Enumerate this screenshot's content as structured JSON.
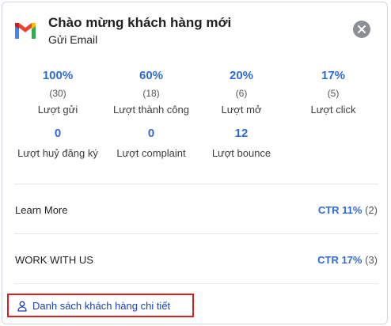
{
  "header": {
    "title": "Chào mừng khách hàng mới",
    "subtitle": "Gửi Email",
    "logo_icon": "gmail-logo-icon",
    "close_icon": "close-icon"
  },
  "stats": [
    {
      "value": "100%",
      "count": "(30)",
      "label": "Lượt gửi"
    },
    {
      "value": "60%",
      "count": "(18)",
      "label": "Lượt thành công"
    },
    {
      "value": "20%",
      "count": "(6)",
      "label": "Lượt mở"
    },
    {
      "value": "17%",
      "count": "(5)",
      "label": "Lượt click"
    },
    {
      "value": "0",
      "label": "Lượt huỷ đăng ký"
    },
    {
      "value": "0",
      "label": "Lượt complaint"
    },
    {
      "value": "12",
      "label": "Lượt bounce"
    }
  ],
  "links": [
    {
      "name": "Learn More",
      "ctr": "CTR 11%",
      "count": "(2)"
    },
    {
      "name": "WORK WITH US",
      "ctr": "CTR 17%",
      "count": "(3)"
    }
  ],
  "detail_link": {
    "label": "Danh sách khách hàng chi tiết",
    "icon": "user-icon"
  },
  "colors": {
    "accent": "#2f6bd8",
    "highlight_border": "#e01e1e",
    "link_text": "#1d3fb8"
  }
}
